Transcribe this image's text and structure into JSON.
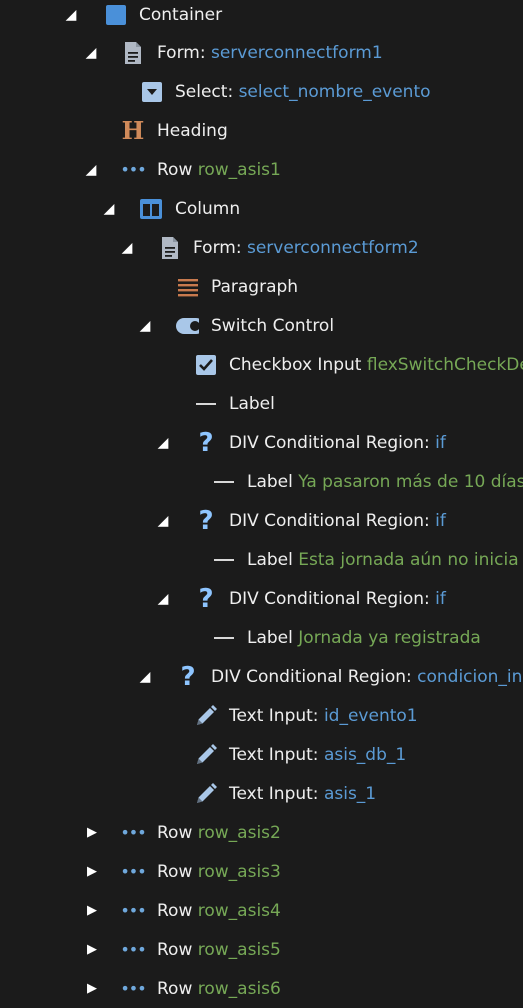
{
  "tree": {
    "container": {
      "label": "Container"
    },
    "form1": {
      "type": "Form:",
      "id": "serverconnectform1"
    },
    "select1": {
      "type": "Select:",
      "id": "select_nombre_evento"
    },
    "heading": {
      "label": "Heading"
    },
    "row1": {
      "type": "Row",
      "id": "row_asis1"
    },
    "column": {
      "label": "Column"
    },
    "form2": {
      "type": "Form:",
      "id": "serverconnectform2"
    },
    "paragraph": {
      "label": "Paragraph"
    },
    "switch": {
      "label": "Switch Control"
    },
    "checkbox": {
      "type": "Checkbox Input",
      "id": "flexSwitchCheckDe"
    },
    "label_plain": {
      "label": "Label"
    },
    "cond1": {
      "type": "DIV Conditional Region:",
      "id": "if"
    },
    "cond1_label": {
      "type": "Label",
      "text": "Ya pasaron más de 10 días"
    },
    "cond2": {
      "type": "DIV Conditional Region:",
      "id": "if"
    },
    "cond2_label": {
      "type": "Label",
      "text": "Esta jornada aún no inicia"
    },
    "cond3": {
      "type": "DIV Conditional Region:",
      "id": "if"
    },
    "cond3_label": {
      "type": "Label",
      "text": "Jornada ya registrada"
    },
    "cond4": {
      "type": "DIV Conditional Region:",
      "id": "condicion_in"
    },
    "text1": {
      "type": "Text Input:",
      "id": "id_evento1"
    },
    "text2": {
      "type": "Text Input:",
      "id": "asis_db_1"
    },
    "text3": {
      "type": "Text Input:",
      "id": "asis_1"
    },
    "row2": {
      "type": "Row",
      "id": "row_asis2"
    },
    "row3": {
      "type": "Row",
      "id": "row_asis3"
    },
    "row4": {
      "type": "Row",
      "id": "row_asis4"
    },
    "row5": {
      "type": "Row",
      "id": "row_asis5"
    },
    "row6": {
      "type": "Row",
      "id": "row_asis6"
    }
  },
  "colors": {
    "blue_id": "#5b9bd5",
    "green_id": "#76a856",
    "background": "#1b1b1b"
  }
}
